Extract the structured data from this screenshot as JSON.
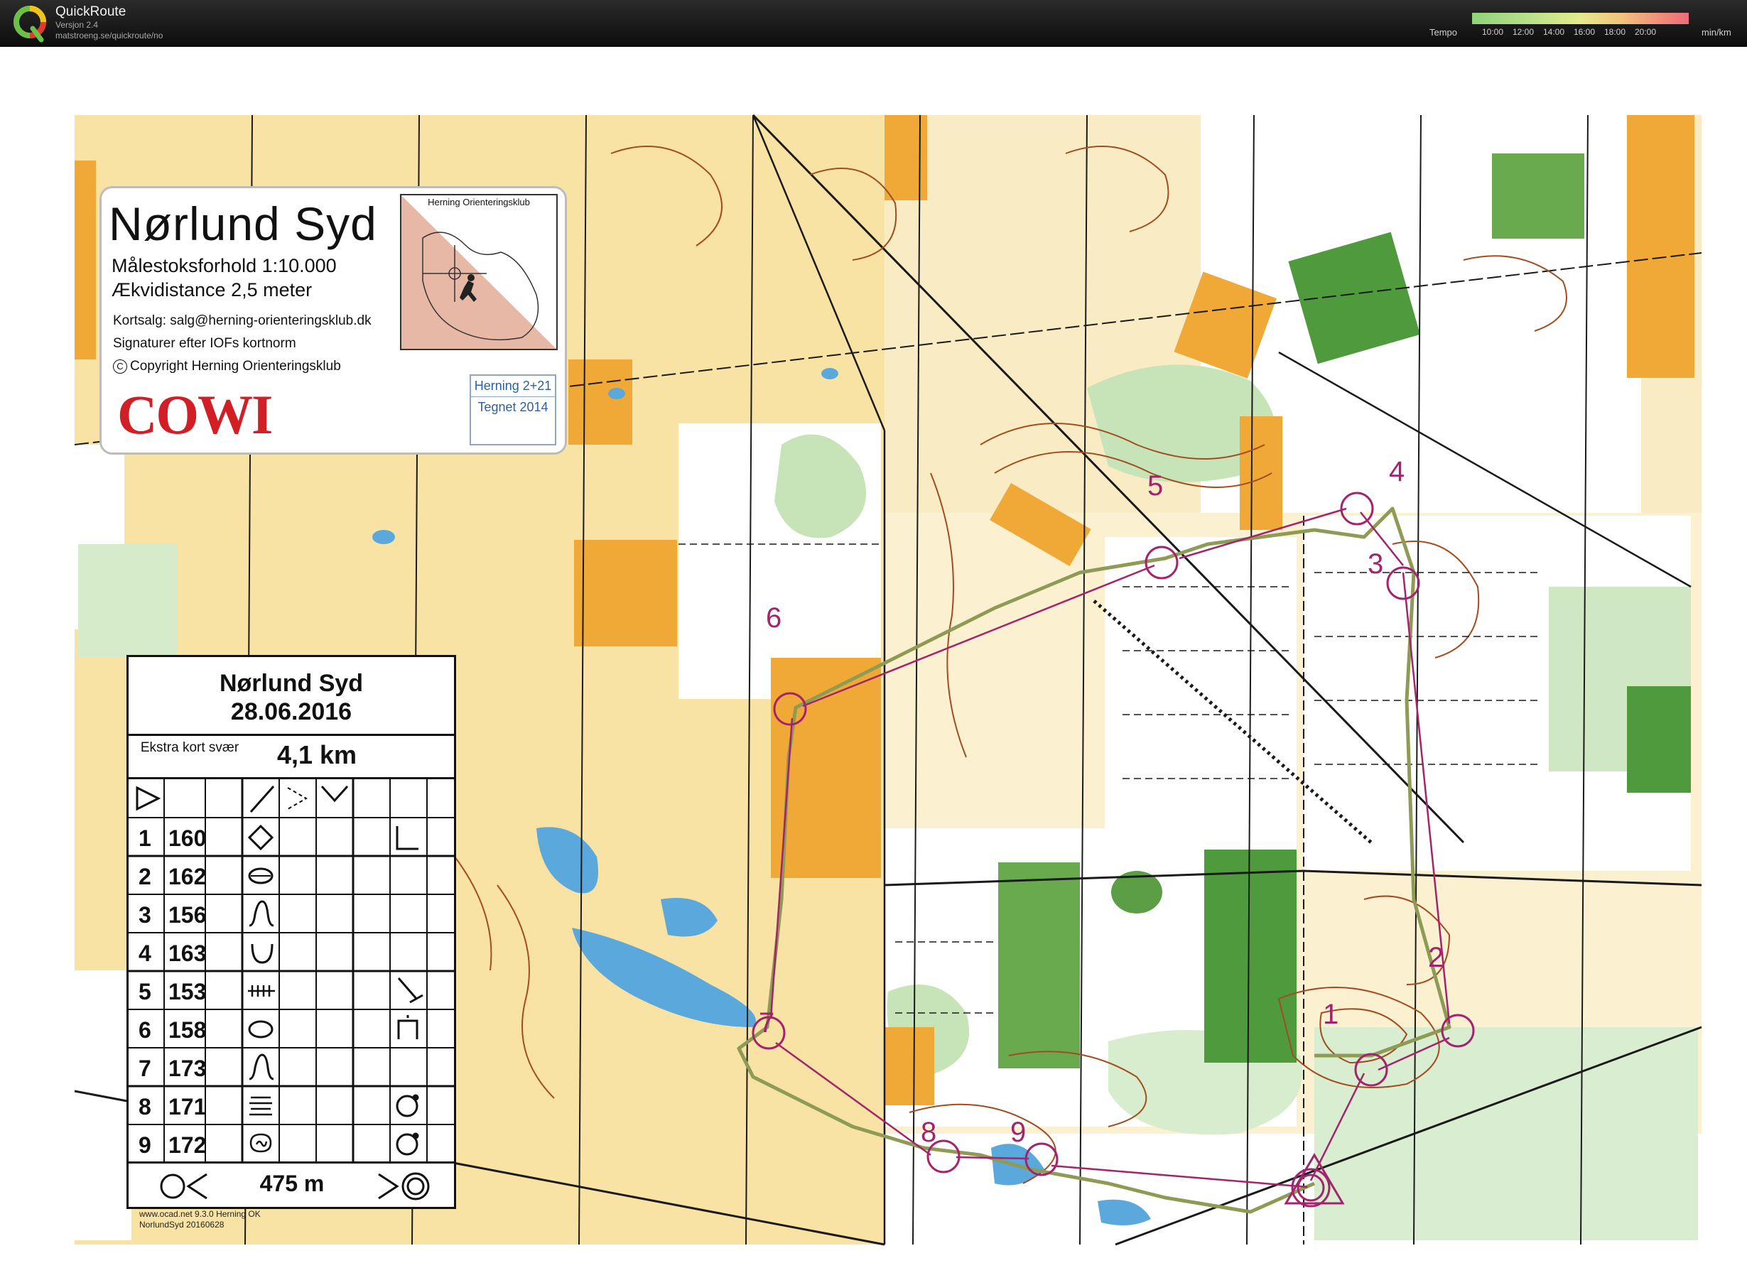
{
  "app": {
    "title": "QuickRoute",
    "version": "Versjon 2.4",
    "url": "matstroeng.se/quickroute/no",
    "tempo_label": "Tempo",
    "tempo_ticks": [
      "10:00",
      "12:00",
      "14:00",
      "16:00",
      "18:00",
      "20:00"
    ],
    "tempo_unit": "min/km"
  },
  "map": {
    "name": "Nørlund Syd",
    "scale_text": "Målestoksforhold 1:10.000",
    "equidistance_text": "Ækvidistance 2,5 meter",
    "sales_text": "Kortsalg: salg@herning-orienteringsklub.dk",
    "symbols_text": "Signaturer efter IOFs kortnorm",
    "copyright_symbol": "C",
    "copyright_text": "Copyright Herning Orienteringsklub",
    "sponsor": "COWI",
    "club_inset_title": "Herning Orienteringsklub",
    "edition": "Herning 2+21",
    "drawn": "Tegnet 2014"
  },
  "course": {
    "name": "Nørlund Syd",
    "date": "28.06.2016",
    "class": "Ekstra kort svær",
    "length": "4,1 km",
    "finish_distance": "475 m",
    "controls": [
      {
        "num": "1",
        "code": "160"
      },
      {
        "num": "2",
        "code": "162"
      },
      {
        "num": "3",
        "code": "156"
      },
      {
        "num": "4",
        "code": "163"
      },
      {
        "num": "5",
        "code": "153"
      },
      {
        "num": "6",
        "code": "158"
      },
      {
        "num": "7",
        "code": "173"
      },
      {
        "num": "8",
        "code": "171"
      },
      {
        "num": "9",
        "code": "172"
      }
    ]
  },
  "print_info": {
    "line1": "www.ocad.net 9.3.0 Herning OK",
    "line2": "NorlundSyd 20160628"
  },
  "colors": {
    "route": "#a3246c",
    "open_land": "#f8e3a4",
    "rough_open": "#f0a937",
    "forest_green": "#5b9e45",
    "water": "#5aa8dc",
    "contour": "#a24d20"
  }
}
